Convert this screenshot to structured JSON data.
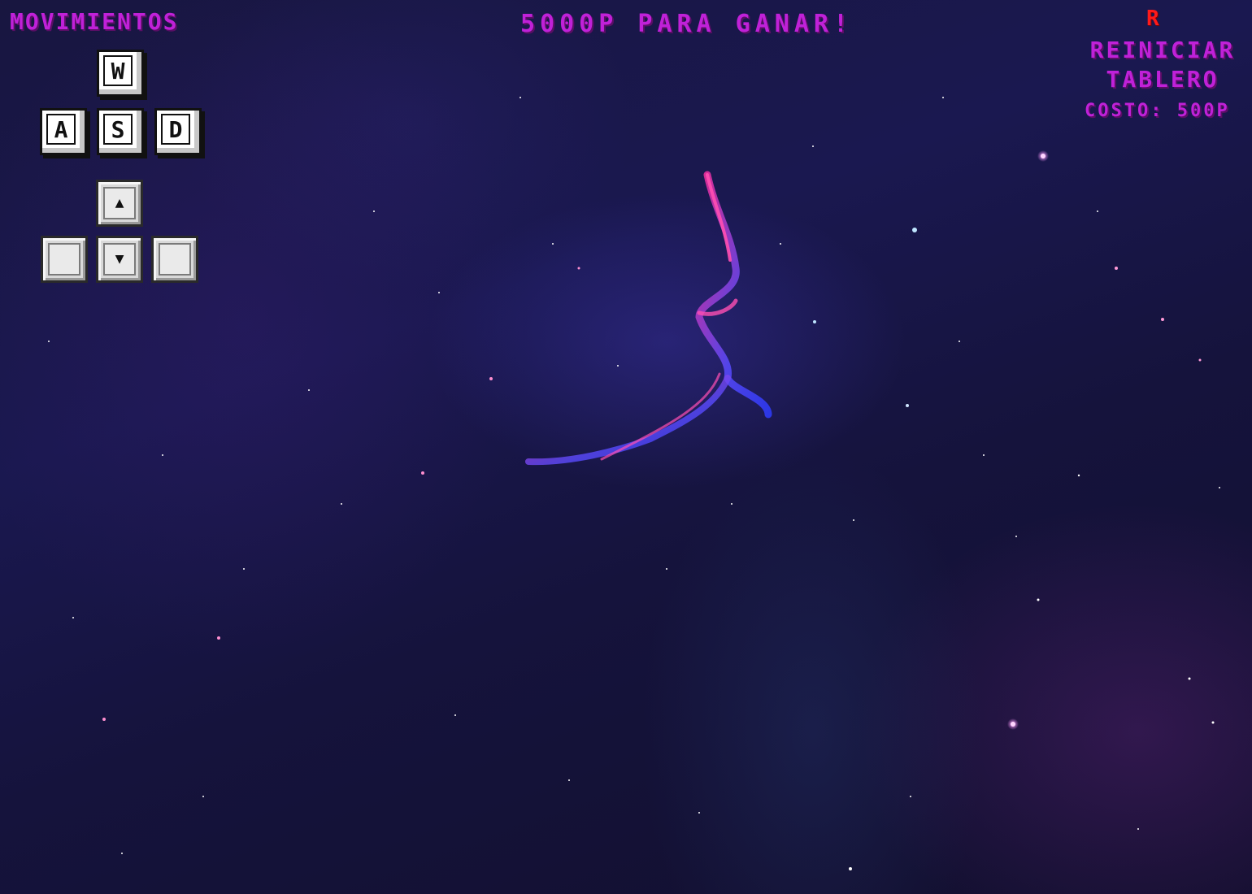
{
  "hud": {
    "controls_title": "MOVIMIENTOS",
    "goal_text": "5000p PARA GANAR!",
    "reset": {
      "key": "R",
      "label_line1": "REINICIAR",
      "label_line2": "TABLERO",
      "cost": "COSTO: 500P"
    }
  },
  "controls": {
    "wasd": {
      "up": "W",
      "left": "A",
      "down": "S",
      "right": "D"
    },
    "arrows": {
      "up_icon": "arrow-up-icon",
      "down_icon": "arrow-down-icon",
      "up_glyph": "▲",
      "down_glyph": "▼"
    }
  },
  "colors": {
    "accent": "#c021d8",
    "reset_key": "#ff1a1a",
    "background": "#181640"
  }
}
